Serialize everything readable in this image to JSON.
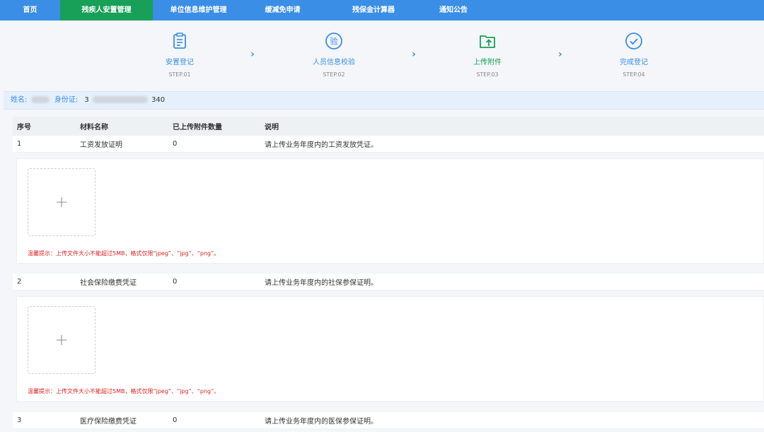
{
  "nav": {
    "items": [
      {
        "label": "首页",
        "active": false
      },
      {
        "label": "残疾人安置管理",
        "active": true
      },
      {
        "label": "单位信息维护管理",
        "active": false
      },
      {
        "label": "缓减免申请",
        "active": false
      },
      {
        "label": "残保金计算器",
        "active": false
      },
      {
        "label": "通知公告",
        "active": false
      }
    ]
  },
  "steps": [
    {
      "label": "安置登记",
      "sub": "STEP.01",
      "icon": "clipboard-icon"
    },
    {
      "label": "人员信息校验",
      "sub": "STEP.02",
      "icon": "verify-icon"
    },
    {
      "label": "上传附件",
      "sub": "STEP.03",
      "icon": "folder-upload-icon",
      "current": true
    },
    {
      "label": "完成登记",
      "sub": "STEP.04",
      "icon": "check-circle-icon"
    }
  ],
  "step_arrow": "›",
  "info": {
    "name_label": "姓名:",
    "id_label": "身份证:",
    "id_prefix": "3",
    "id_suffix": "340"
  },
  "table": {
    "headers": [
      "序号",
      "材料名称",
      "已上传附件数量",
      "说明"
    ],
    "rows": [
      {
        "no": "1",
        "name": "工资发放证明",
        "count": "0",
        "desc": "请上传业务年度内的工资发放凭证。"
      },
      {
        "no": "2",
        "name": "社会保险缴费凭证",
        "count": "0",
        "desc": "请上传业务年度内的社保参保证明。"
      },
      {
        "no": "3",
        "name": "医疗保险缴费凭证",
        "count": "0",
        "desc": "请上传业务年度内的医保参保证明。"
      }
    ],
    "upload_tip": "温馨提示：上传文件大小不能超过5MB，格式仅限“jpeg”、“jpg”、“png”。"
  },
  "colors": {
    "nav_bg": "#3a8ee6",
    "nav_active": "#18a058",
    "step_color": "#3a8ee6",
    "current_step": "#18a058",
    "tip_red": "#e02020"
  }
}
